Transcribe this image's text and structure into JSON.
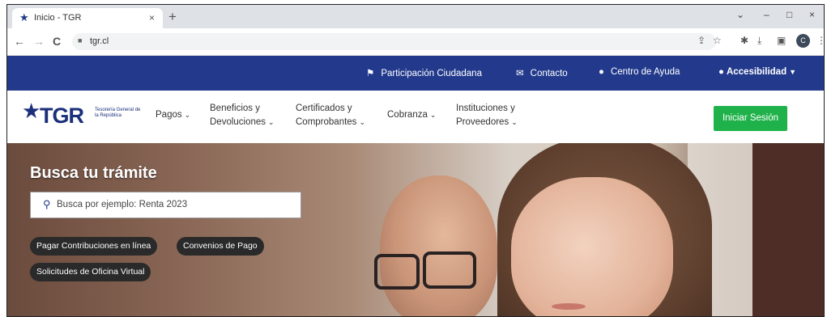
{
  "browser": {
    "tab_title": "Inicio - TGR",
    "tab_close": "×",
    "new_tab": "+",
    "url": "tgr.cl",
    "window_controls": {
      "chevron": "⌄",
      "minimize": "–",
      "maximize": "□",
      "close": "×"
    },
    "nav": {
      "back": "←",
      "forward": "→",
      "reload": "C"
    },
    "toolbar_icons": [
      "share-icon",
      "star-icon",
      "extensions-icon",
      "download-icon",
      "sidebar-icon",
      "profile-icon",
      "menu-icon"
    ],
    "profile_initial": "C"
  },
  "topbar": {
    "background": "#233a8c",
    "links": [
      {
        "label": "Participación Ciudadana",
        "icon": "people-icon"
      },
      {
        "label": "Contacto",
        "icon": "mail-icon"
      },
      {
        "label": "Centro de Ayuda",
        "icon": "help-icon"
      },
      {
        "label": "Accesibilidad",
        "icon": "accessibility-icon"
      }
    ]
  },
  "logo": {
    "text": "TGR",
    "subtitle": "Tesorería General de la República",
    "color": "#1b2f7a"
  },
  "nav": {
    "items": [
      {
        "line1": "Pagos",
        "line2": ""
      },
      {
        "line1": "Beneficios y",
        "line2": "Devoluciones"
      },
      {
        "line1": "Certificados y",
        "line2": "Comprobantes"
      },
      {
        "line1": "Cobranza",
        "line2": ""
      },
      {
        "line1": "Instituciones y",
        "line2": "Proveedores"
      }
    ],
    "login_label": "Iniciar Sesión",
    "login_color": "#1fb24a"
  },
  "hero": {
    "title": "Busca tu trámite",
    "search_placeholder": "Busca por ejemplo: Renta 2023",
    "chips": [
      "Pagar Contribuciones en línea",
      "Convenios de Pago",
      "Solicitudes de Oficina Virtual"
    ]
  }
}
